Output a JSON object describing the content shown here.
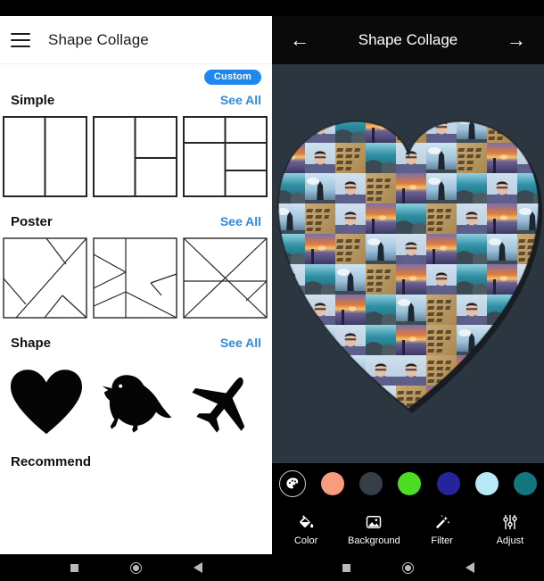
{
  "left": {
    "appbar": {
      "menu_icon": "hamburger-menu-icon",
      "title": "Shape Collage"
    },
    "custom_badge": "Custom",
    "sections": [
      {
        "id": "simple",
        "title": "Simple",
        "see_all": "See All"
      },
      {
        "id": "poster",
        "title": "Poster",
        "see_all": "See All"
      },
      {
        "id": "shape",
        "title": "Shape",
        "see_all": "See All"
      }
    ],
    "shapes": [
      {
        "name": "heart-shape",
        "label": "Heart"
      },
      {
        "name": "bird-shape",
        "label": "Bird"
      },
      {
        "name": "plane-shape",
        "label": "Plane"
      }
    ],
    "recommend_title": "Recommend",
    "accent_color": "#2f8ae0",
    "badge_color": "#1e87f0"
  },
  "right": {
    "appbar": {
      "back_icon": "arrow-left-icon",
      "title": "Shape Collage",
      "forward_icon": "arrow-right-icon"
    },
    "canvas": {
      "shape": "heart",
      "background_color": "#2b3640",
      "collage_tile_count": 9
    },
    "palette_icon": "color-palette-icon",
    "swatches": [
      {
        "name": "swatch-salmon",
        "color": "#f79d7e"
      },
      {
        "name": "swatch-dark-slate",
        "color": "#343f47"
      },
      {
        "name": "swatch-green",
        "color": "#4ddd21"
      },
      {
        "name": "swatch-navy",
        "color": "#26249a"
      },
      {
        "name": "swatch-pale-blue",
        "color": "#b9e9f6"
      },
      {
        "name": "swatch-teal",
        "color": "#11777c"
      }
    ],
    "tools": [
      {
        "name": "tool-color",
        "icon": "paint-bucket-icon",
        "label": "Color"
      },
      {
        "name": "tool-background",
        "icon": "image-icon",
        "label": "Background"
      },
      {
        "name": "tool-filter",
        "icon": "magic-wand-icon",
        "label": "Filter"
      },
      {
        "name": "tool-adjust",
        "icon": "sliders-icon",
        "label": "Adjust"
      }
    ]
  },
  "sysnav": {
    "recent_icon": "square-recents-icon",
    "home_icon": "circle-home-icon",
    "back_icon": "triangle-back-icon"
  }
}
